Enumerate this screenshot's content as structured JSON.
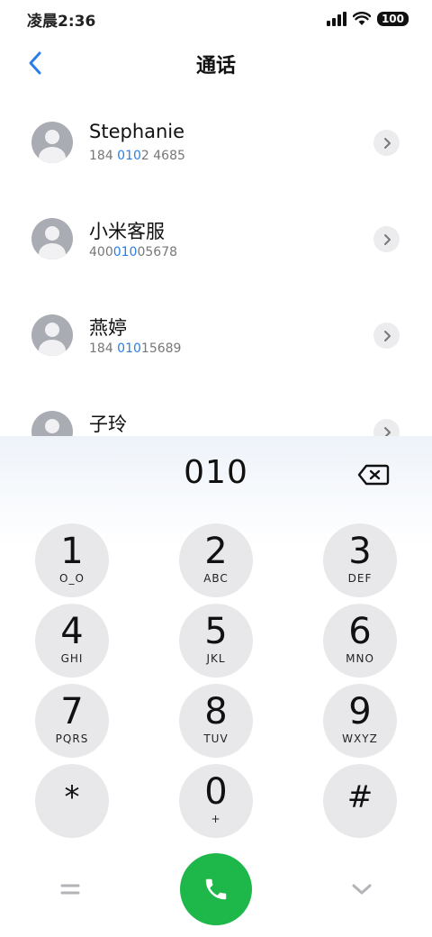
{
  "status_bar": {
    "time": "凌晨2:36",
    "battery": "100"
  },
  "header": {
    "title": "通话"
  },
  "contacts": [
    {
      "name": "Stephanie",
      "number_pre": "184 ",
      "number_match": "010",
      "number_post": "2 4685"
    },
    {
      "name": "小米客服",
      "number_pre": "400",
      "number_match": "010",
      "number_post": "05678"
    },
    {
      "name": "燕婷",
      "number_pre": "184 ",
      "number_match": "010",
      "number_post": "15689"
    },
    {
      "name": "子玲",
      "number_pre": "",
      "number_match": "",
      "number_post": ""
    }
  ],
  "dialpad": {
    "input": "010",
    "keys": [
      {
        "digit": "1",
        "letters": "O_O"
      },
      {
        "digit": "2",
        "letters": "ABC"
      },
      {
        "digit": "3",
        "letters": "DEF"
      },
      {
        "digit": "4",
        "letters": "GHI"
      },
      {
        "digit": "5",
        "letters": "JKL"
      },
      {
        "digit": "6",
        "letters": "MNO"
      },
      {
        "digit": "7",
        "letters": "PQRS"
      },
      {
        "digit": "8",
        "letters": "TUV"
      },
      {
        "digit": "9",
        "letters": "WXYZ"
      },
      {
        "digit": "*",
        "letters": ""
      },
      {
        "digit": "0",
        "letters": "+"
      },
      {
        "digit": "#",
        "letters": ""
      }
    ]
  },
  "icons": {
    "back": "chevron-left-icon",
    "backspace": "backspace-icon",
    "call": "phone-icon",
    "menu": "equals-icon",
    "collapse": "chevron-down-icon"
  },
  "colors": {
    "accent": "#2b7de9",
    "call": "#1db74a"
  }
}
